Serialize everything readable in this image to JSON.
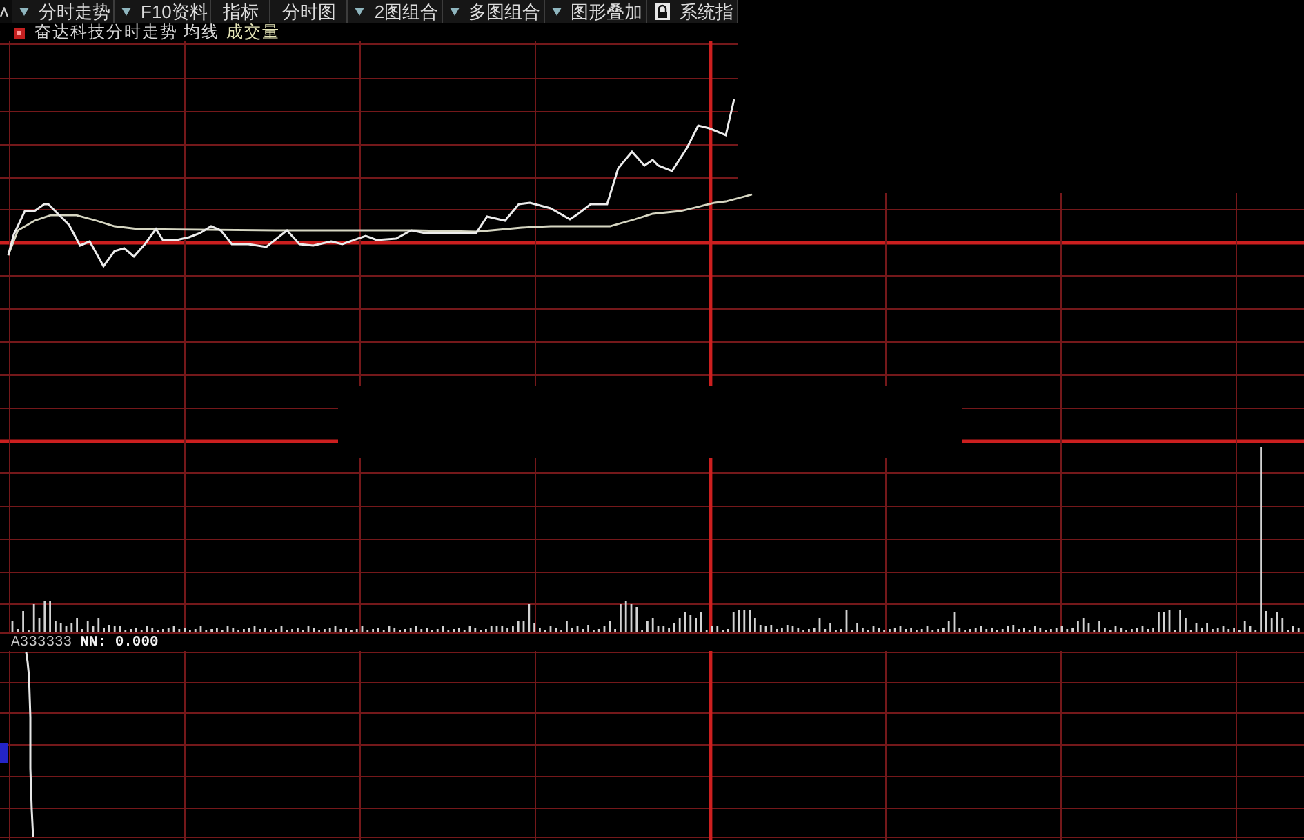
{
  "toolbar": {
    "items": [
      {
        "kind": "menu",
        "label": "分时走势"
      },
      {
        "kind": "menu",
        "label": "F10资料"
      },
      {
        "kind": "plain",
        "label": "指标"
      },
      {
        "kind": "plain",
        "label": "分时图"
      },
      {
        "kind": "menu",
        "label": "2图组合"
      },
      {
        "kind": "menu",
        "label": "多图组合"
      },
      {
        "kind": "menu",
        "label": "图形叠加"
      },
      {
        "kind": "locked",
        "label": "系统指"
      }
    ]
  },
  "chart": {
    "title": "奋达科技分时走势",
    "legend": [
      "均线",
      "成交量"
    ]
  },
  "indicator": {
    "name": "A333333",
    "reading": "NN: 0.000"
  }
}
